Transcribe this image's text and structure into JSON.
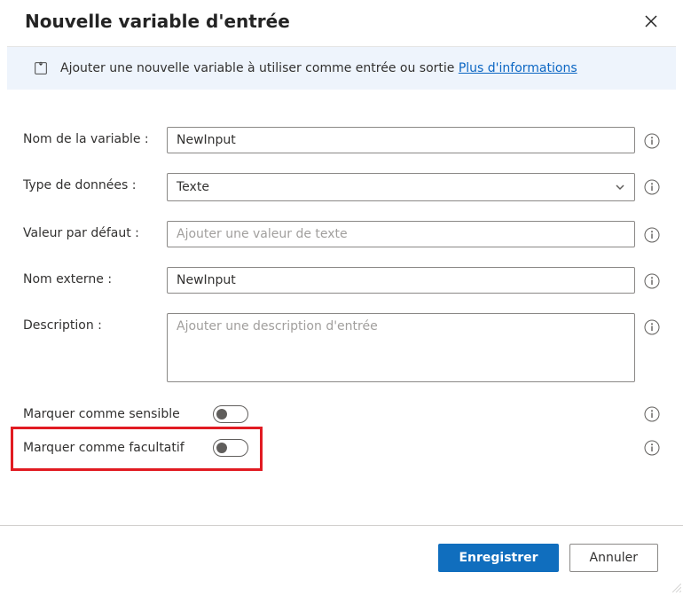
{
  "header": {
    "title": "Nouvelle variable d'entrée"
  },
  "info": {
    "message": "Ajouter une nouvelle variable à utiliser comme entrée ou sortie ",
    "link_text": "Plus d'informations"
  },
  "form": {
    "variable_name": {
      "label": "Nom de la variable :",
      "value": "NewInput"
    },
    "data_type": {
      "label": "Type de données :",
      "value": "Texte"
    },
    "default_value": {
      "label": "Valeur par défaut :",
      "value": "",
      "placeholder": "Ajouter une valeur de texte"
    },
    "external_name": {
      "label": "Nom externe :",
      "value": "NewInput"
    },
    "description": {
      "label": "Description :",
      "value": "",
      "placeholder": "Ajouter une description d'entrée"
    },
    "mark_sensitive": {
      "label": "Marquer comme sensible",
      "value": false
    },
    "mark_optional": {
      "label": "Marquer comme facultatif",
      "value": false
    }
  },
  "footer": {
    "save": "Enregistrer",
    "cancel": "Annuler"
  }
}
